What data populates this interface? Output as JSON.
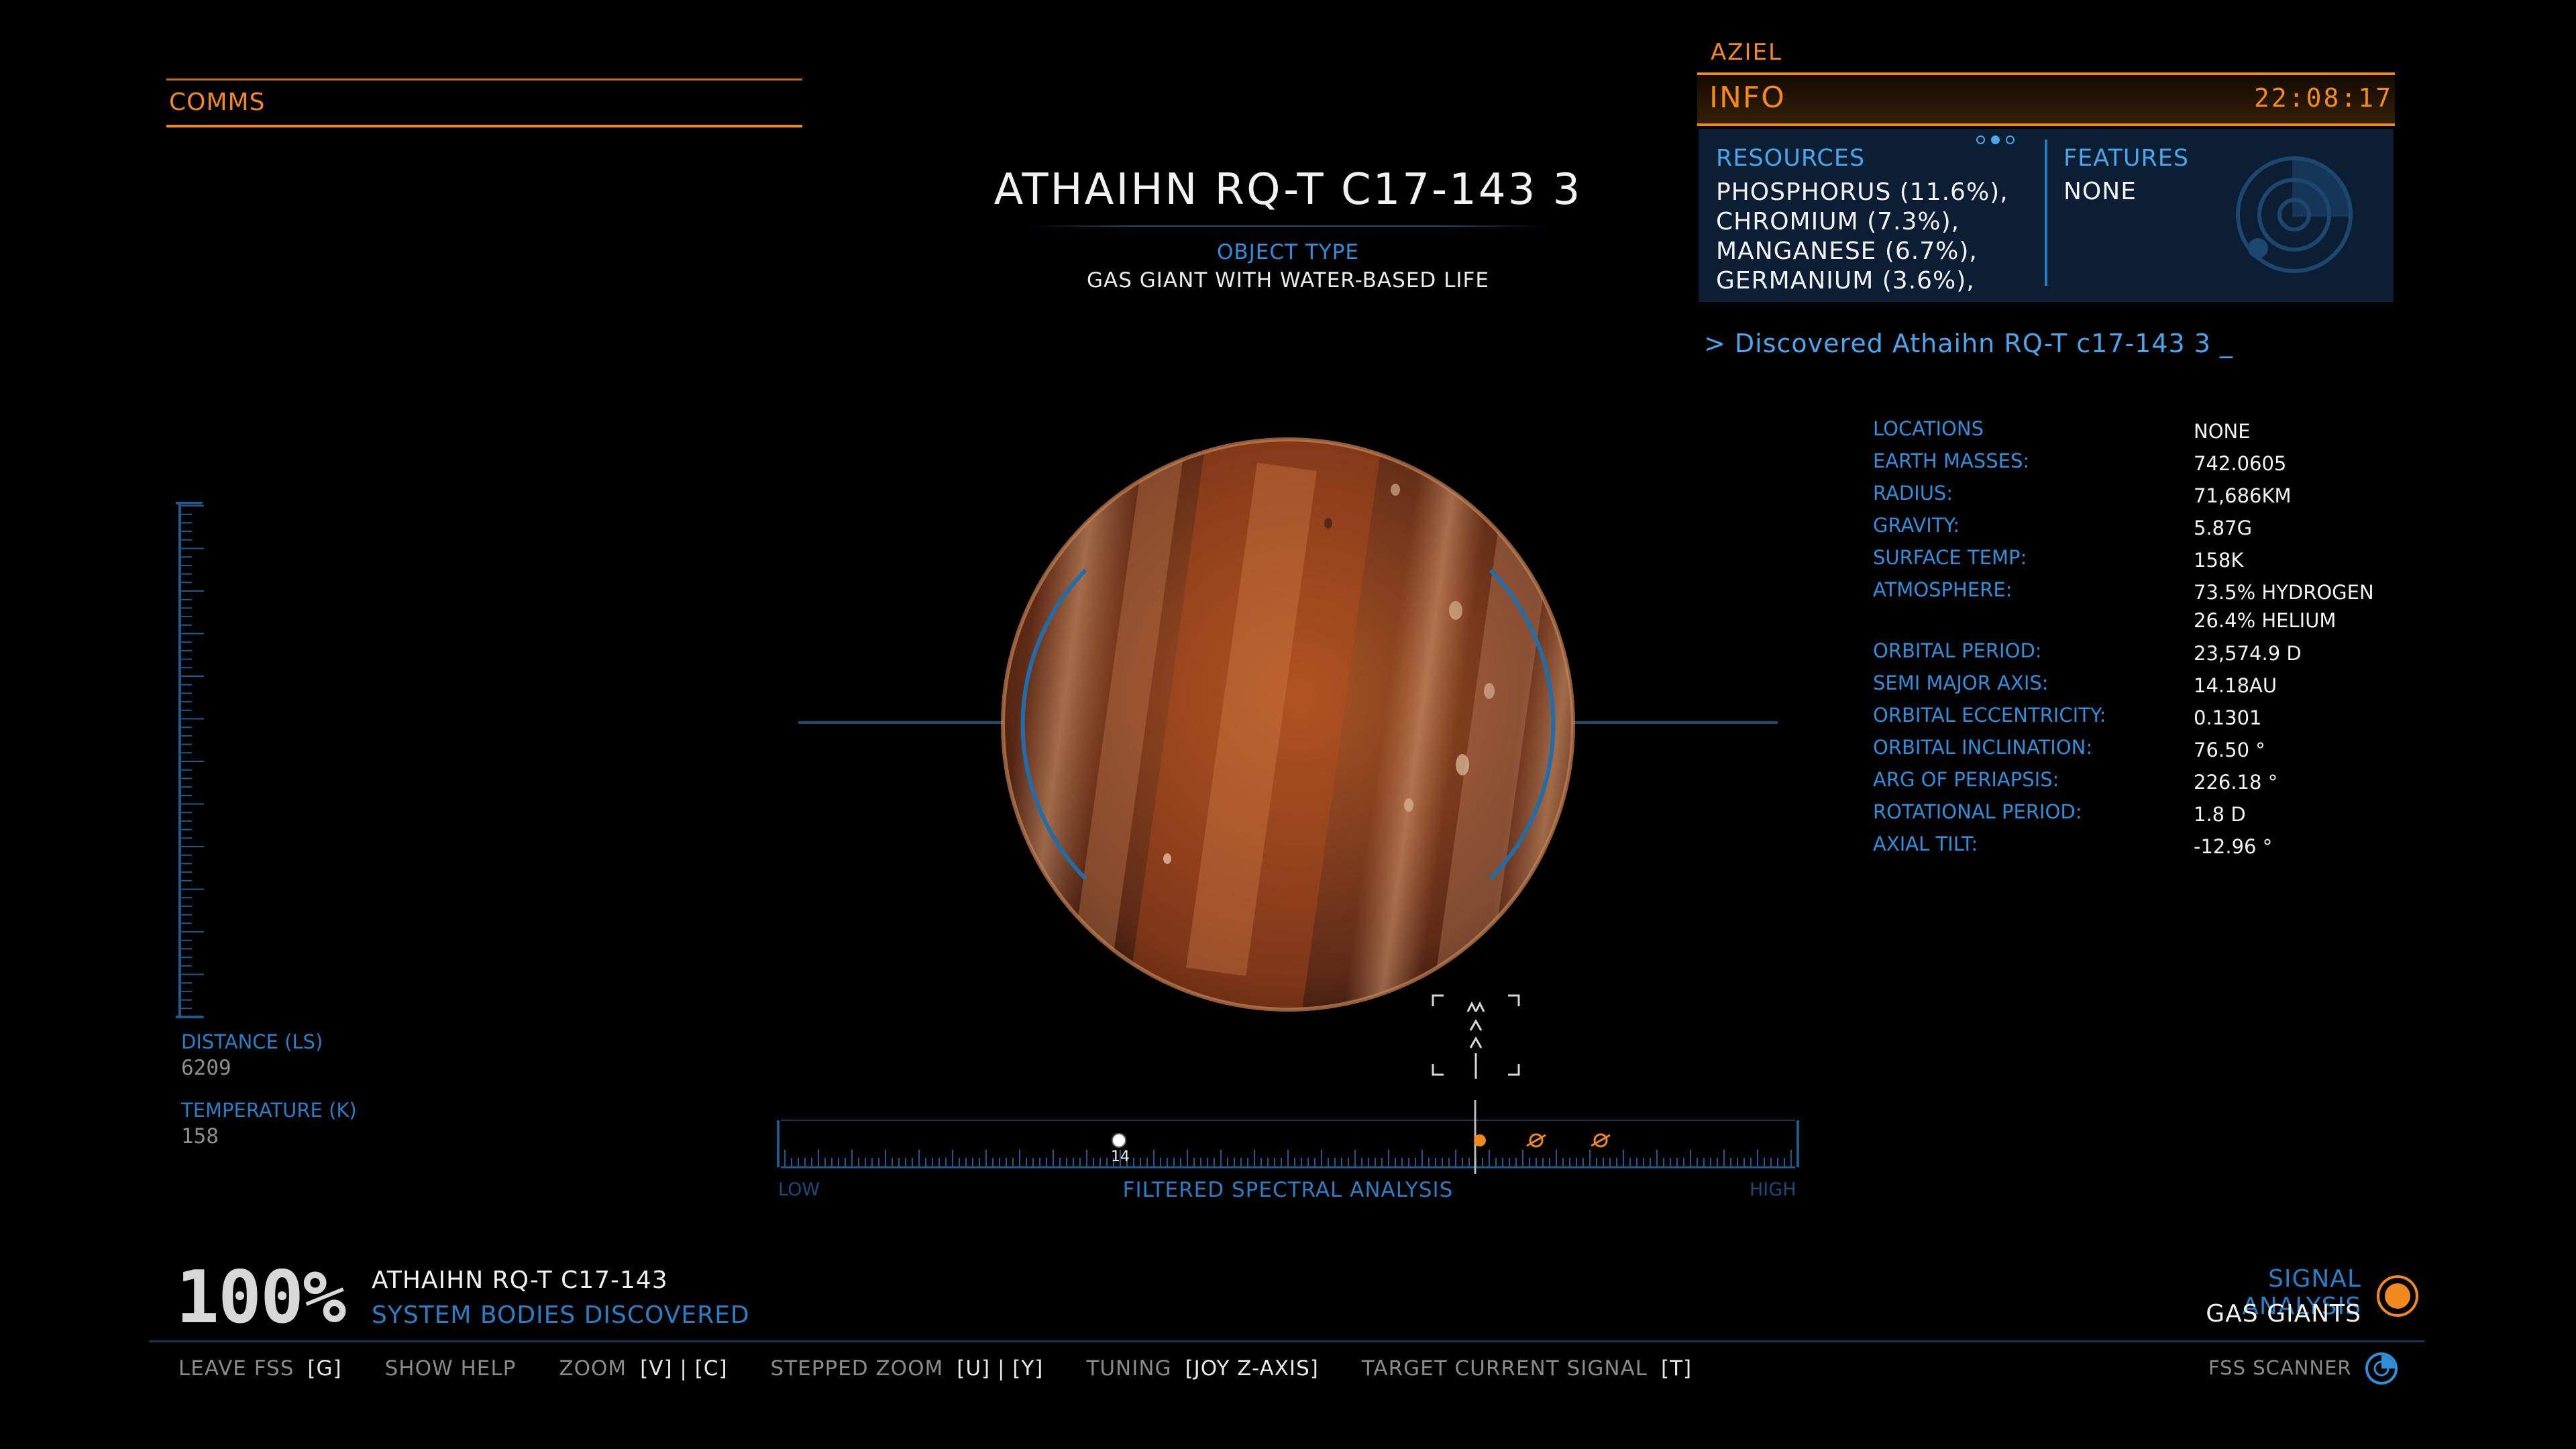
{
  "comms": {
    "label": "COMMS"
  },
  "body": {
    "name": "ATHAIHN RQ-T C17-143 3",
    "object_type_label": "OBJECT TYPE",
    "object_type_value": "GAS GIANT WITH WATER-BASED LIFE"
  },
  "info": {
    "commander": "AZIEL",
    "title": "INFO",
    "time": "22:08:17",
    "resources_label": "RESOURCES",
    "resources": [
      "PHOSPHORUS (11.6%),",
      "CHROMIUM (7.3%),",
      "MANGANESE (6.7%),",
      "GERMANIUM (3.6%),"
    ],
    "features_label": "FEATURES",
    "features_value": "NONE",
    "discovered_text": "> Discovered Athaihn RQ-T c17-143 3  _"
  },
  "stats": [
    {
      "label": "LOCATIONS",
      "value": "NONE"
    },
    {
      "label": "EARTH MASSES:",
      "value": "742.0605"
    },
    {
      "label": "RADIUS:",
      "value": "71,686KM"
    },
    {
      "label": "GRAVITY:",
      "value": "5.87G"
    },
    {
      "label": "SURFACE TEMP:",
      "value": "158K"
    },
    {
      "label": "ATMOSPHERE:",
      "value": "73.5% HYDROGEN",
      "value2": "26.4% HELIUM"
    },
    {
      "label": "ORBITAL PERIOD:",
      "value": "23,574.9 D"
    },
    {
      "label": "SEMI MAJOR AXIS:",
      "value": "14.18AU"
    },
    {
      "label": "ORBITAL ECCENTRICITY:",
      "value": "0.1301"
    },
    {
      "label": "ORBITAL INCLINATION:",
      "value": "76.50 °"
    },
    {
      "label": "ARG OF PERIAPSIS:",
      "value": "226.18 °"
    },
    {
      "label": "ROTATIONAL PERIOD:",
      "value": "1.8 D"
    },
    {
      "label": "AXIAL TILT:",
      "value": "-12.96 °"
    }
  ],
  "gauge": {
    "distance_label": "DISTANCE (LS)",
    "distance_value": "6209",
    "temperature_label": "TEMPERATURE (K)",
    "temperature_value": "158"
  },
  "spectral": {
    "low_label": "LOW",
    "high_label": "HIGH",
    "title": "FILTERED SPECTRAL ANALYSIS",
    "count": "14"
  },
  "progress": {
    "percent": "100%",
    "system_name": "ATHAIHN RQ-T C17-143",
    "subtitle": "SYSTEM BODIES DISCOVERED"
  },
  "signal": {
    "label": "SIGNAL ANALYSIS",
    "value": "GAS GIANTS"
  },
  "controls": [
    {
      "label": "LEAVE FSS",
      "key": "[G]"
    },
    {
      "label": "SHOW HELP",
      "key": ""
    },
    {
      "label": "ZOOM",
      "key": "[V] | [C]"
    },
    {
      "label": "STEPPED ZOOM",
      "key": "[U] | [Y]"
    },
    {
      "label": "TUNING",
      "key": "[JOY Z-AXIS]"
    },
    {
      "label": "TARGET CURRENT SIGNAL",
      "key": "[T]"
    }
  ],
  "fss_label": "FSS SCANNER",
  "colors": {
    "orange": "#f08a1c",
    "blue": "#2f8fd8",
    "panel": "#0c1e33"
  }
}
